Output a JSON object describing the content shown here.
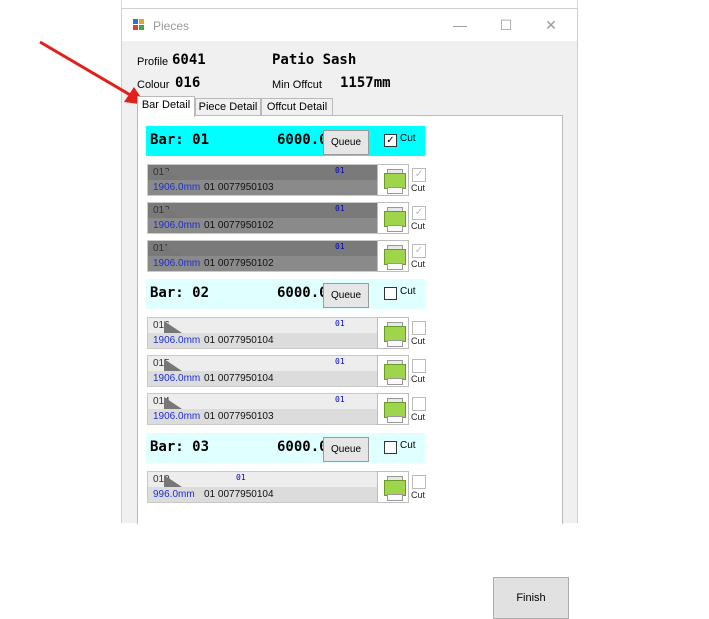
{
  "window": {
    "title": "Pieces",
    "minimize": "—",
    "maximize": "☐",
    "close": "✕"
  },
  "header": {
    "profile_label": "Profile",
    "profile_value": "6041",
    "profile_desc": "Patio Sash",
    "colour_label": "Colour",
    "colour_value": "016",
    "min_offcut_label": "Min Offcut",
    "min_offcut_value": "1157mm"
  },
  "tabs": [
    "Bar Detail",
    "Piece Detail",
    "Offcut Detail"
  ],
  "bars": [
    {
      "title": "Bar: 01",
      "length": "6000.0",
      "queue_label": "Queue",
      "cut_label": "Cut",
      "cut_checked": true,
      "highlight_color": "#00ffff",
      "pieces": [
        {
          "num": "013",
          "len": "1906.0mm",
          "info": "01 0077950103",
          "code": "01",
          "cut": true
        },
        {
          "num": "012",
          "len": "1906.0mm",
          "info": "01 0077950102",
          "code": "01",
          "cut": true
        },
        {
          "num": "011",
          "len": "1906.0mm",
          "info": "01 0077950102",
          "code": "01",
          "cut": true
        }
      ]
    },
    {
      "title": "Bar: 02",
      "length": "6000.0",
      "queue_label": "Queue",
      "cut_label": "Cut",
      "cut_checked": false,
      "highlight_color": "#e0ffff",
      "pieces": [
        {
          "num": "016",
          "len": "1906.0mm",
          "info": "01 0077950104",
          "code": "01",
          "cut": false
        },
        {
          "num": "015",
          "len": "1906.0mm",
          "info": "01 0077950104",
          "code": "01",
          "cut": false
        },
        {
          "num": "014",
          "len": "1906.0mm",
          "info": "01 0077950103",
          "code": "01",
          "cut": false
        }
      ]
    },
    {
      "title": "Bar: 03",
      "length": "6000.0",
      "queue_label": "Queue",
      "cut_label": "Cut",
      "cut_checked": false,
      "highlight_color": "#e0ffff",
      "pieces": [
        {
          "num": "010",
          "len": "996.0mm",
          "info": "01 0077950104",
          "code": "01",
          "cut": false
        }
      ]
    }
  ],
  "piece_cut_label": "Cut",
  "finish_label": "Finish",
  "annotation": {
    "arrow_color": "#e0201b"
  }
}
